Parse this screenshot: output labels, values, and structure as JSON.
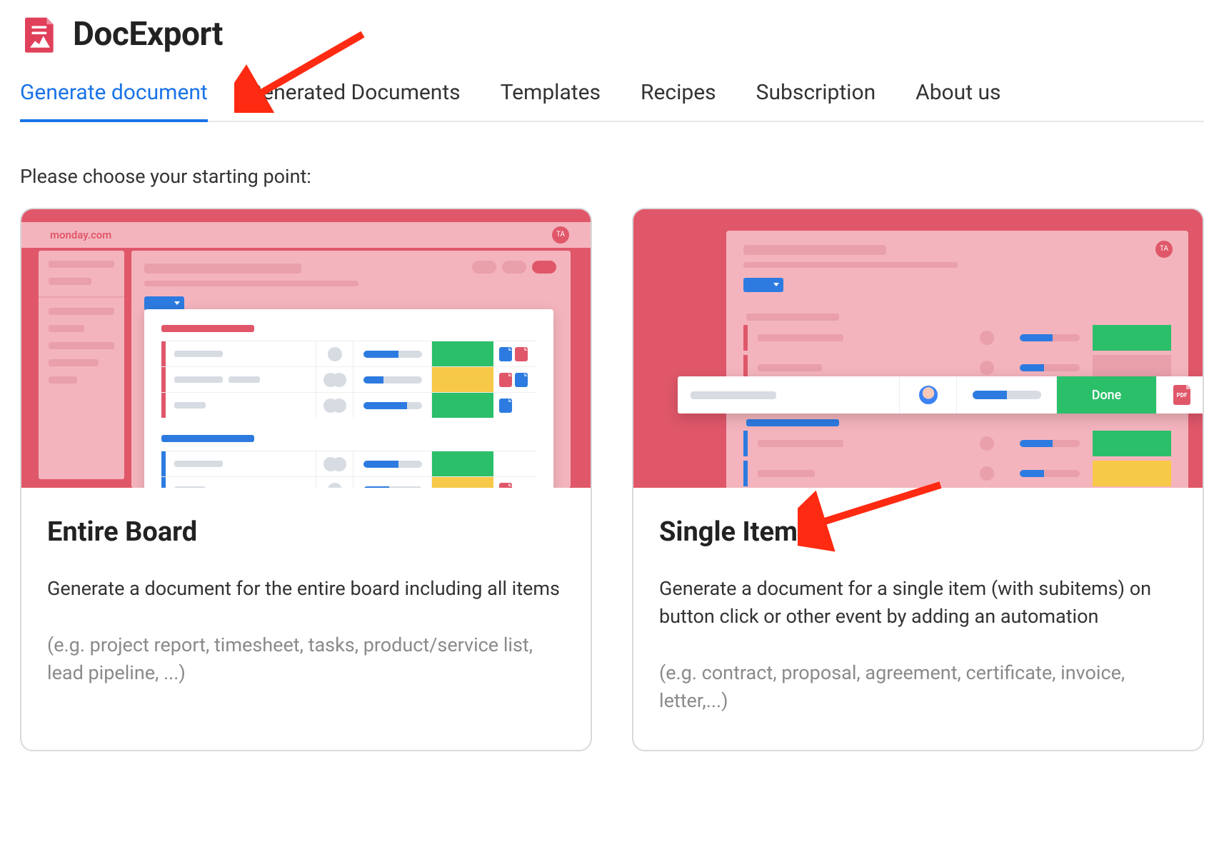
{
  "brand": "DocExport",
  "tabs": [
    {
      "label": "Generate document",
      "active": true
    },
    {
      "label": "Generated Documents",
      "active": false
    },
    {
      "label": "Templates",
      "active": false
    },
    {
      "label": "Recipes",
      "active": false
    },
    {
      "label": "Subscription",
      "active": false
    },
    {
      "label": "About us",
      "active": false
    }
  ],
  "instruction": "Please choose your starting point:",
  "cards": {
    "entire_board": {
      "title": "Entire Board",
      "desc": "Generate a document for the entire board including all items",
      "eg": "(e.g. project report, timesheet, tasks, product/service list, lead pipeline, ...)"
    },
    "single_item": {
      "title": "Single Item",
      "desc": "Generate a document for a single item (with subitems) on button click or other event by adding an automation",
      "eg": "(e.g. contract, proposal, agreement, certificate, invoice, letter,...)"
    }
  },
  "illus": {
    "board_topbar_text": "monday.com",
    "badge_initials": "TA",
    "focus_status_label": "Done",
    "focus_file_label": "PDF"
  },
  "annotations": {
    "arrow_to_generate_tab": true,
    "arrow_to_single_item": true
  },
  "colors": {
    "accent_blue": "#1a73e8",
    "brand_red": "#e0576a",
    "status_green": "#2bbf6a",
    "status_yellow": "#f7c948"
  }
}
